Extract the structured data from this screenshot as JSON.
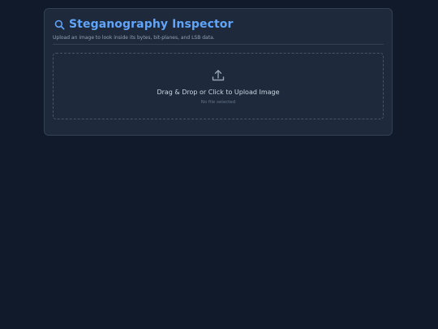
{
  "app": {
    "title": "Steganography Inspector",
    "subtitle": "Upload an image to look inside its bytes, bit-planes, and LSB data."
  },
  "upload": {
    "label": "Drag & Drop or Click to Upload Image",
    "status": "No file selected"
  },
  "icons": {
    "title_icon": "search-icon",
    "upload_icon": "upload-icon"
  },
  "colors": {
    "background": "#111a2b",
    "card": "#1e293b",
    "accent": "#60a5fa",
    "muted_text": "#94a3b8"
  }
}
